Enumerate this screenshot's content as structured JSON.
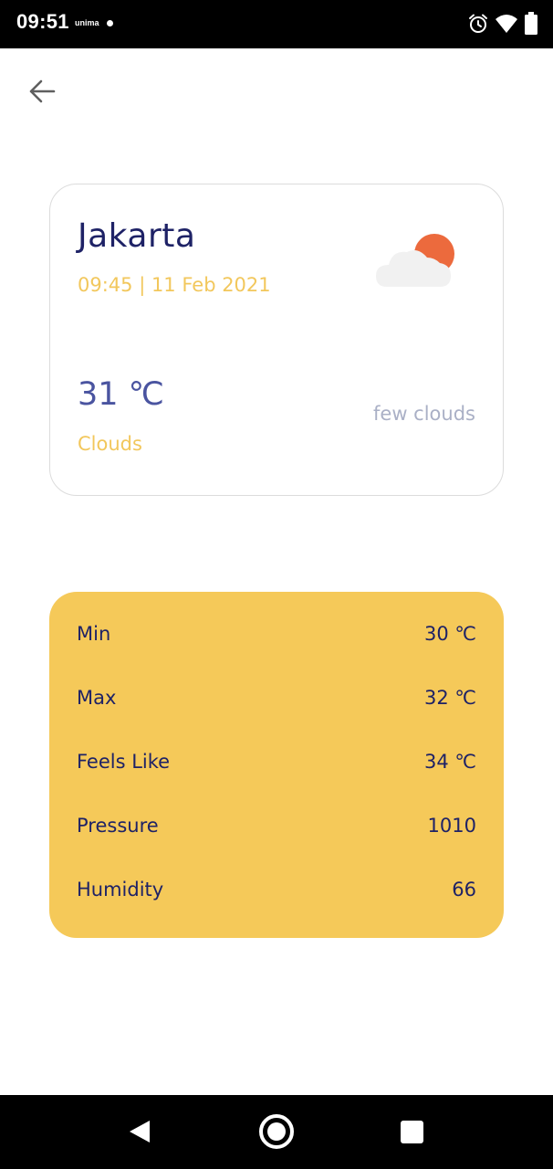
{
  "status_bar": {
    "time": "09:51",
    "carrier": "unima",
    "icons": [
      "alarm-icon",
      "wifi-icon",
      "battery-icon"
    ]
  },
  "header": {
    "back_icon": "arrow-left-icon"
  },
  "weather": {
    "city": "Jakarta",
    "datetime": "09:45 | 11 Feb 2021",
    "temperature": "31 ℃",
    "condition": "Clouds",
    "description": "few clouds",
    "icon": "few-clouds-day-icon"
  },
  "details": [
    {
      "label": "Min",
      "value": "30 ℃"
    },
    {
      "label": "Max",
      "value": "32 ℃"
    },
    {
      "label": "Feels Like",
      "value": "34 ℃"
    },
    {
      "label": "Pressure",
      "value": "1010"
    },
    {
      "label": "Humidity",
      "value": "66"
    }
  ],
  "nav_bar": {
    "buttons": [
      "nav-back-icon",
      "nav-home-icon",
      "nav-recents-icon"
    ]
  },
  "colors": {
    "primary_text": "#1e2266",
    "accent_yellow": "#f5c959",
    "secondary_text": "#f2c75c",
    "temperature": "#4a54a0",
    "muted": "#aab0c6",
    "sun": "#ec6a3d"
  }
}
